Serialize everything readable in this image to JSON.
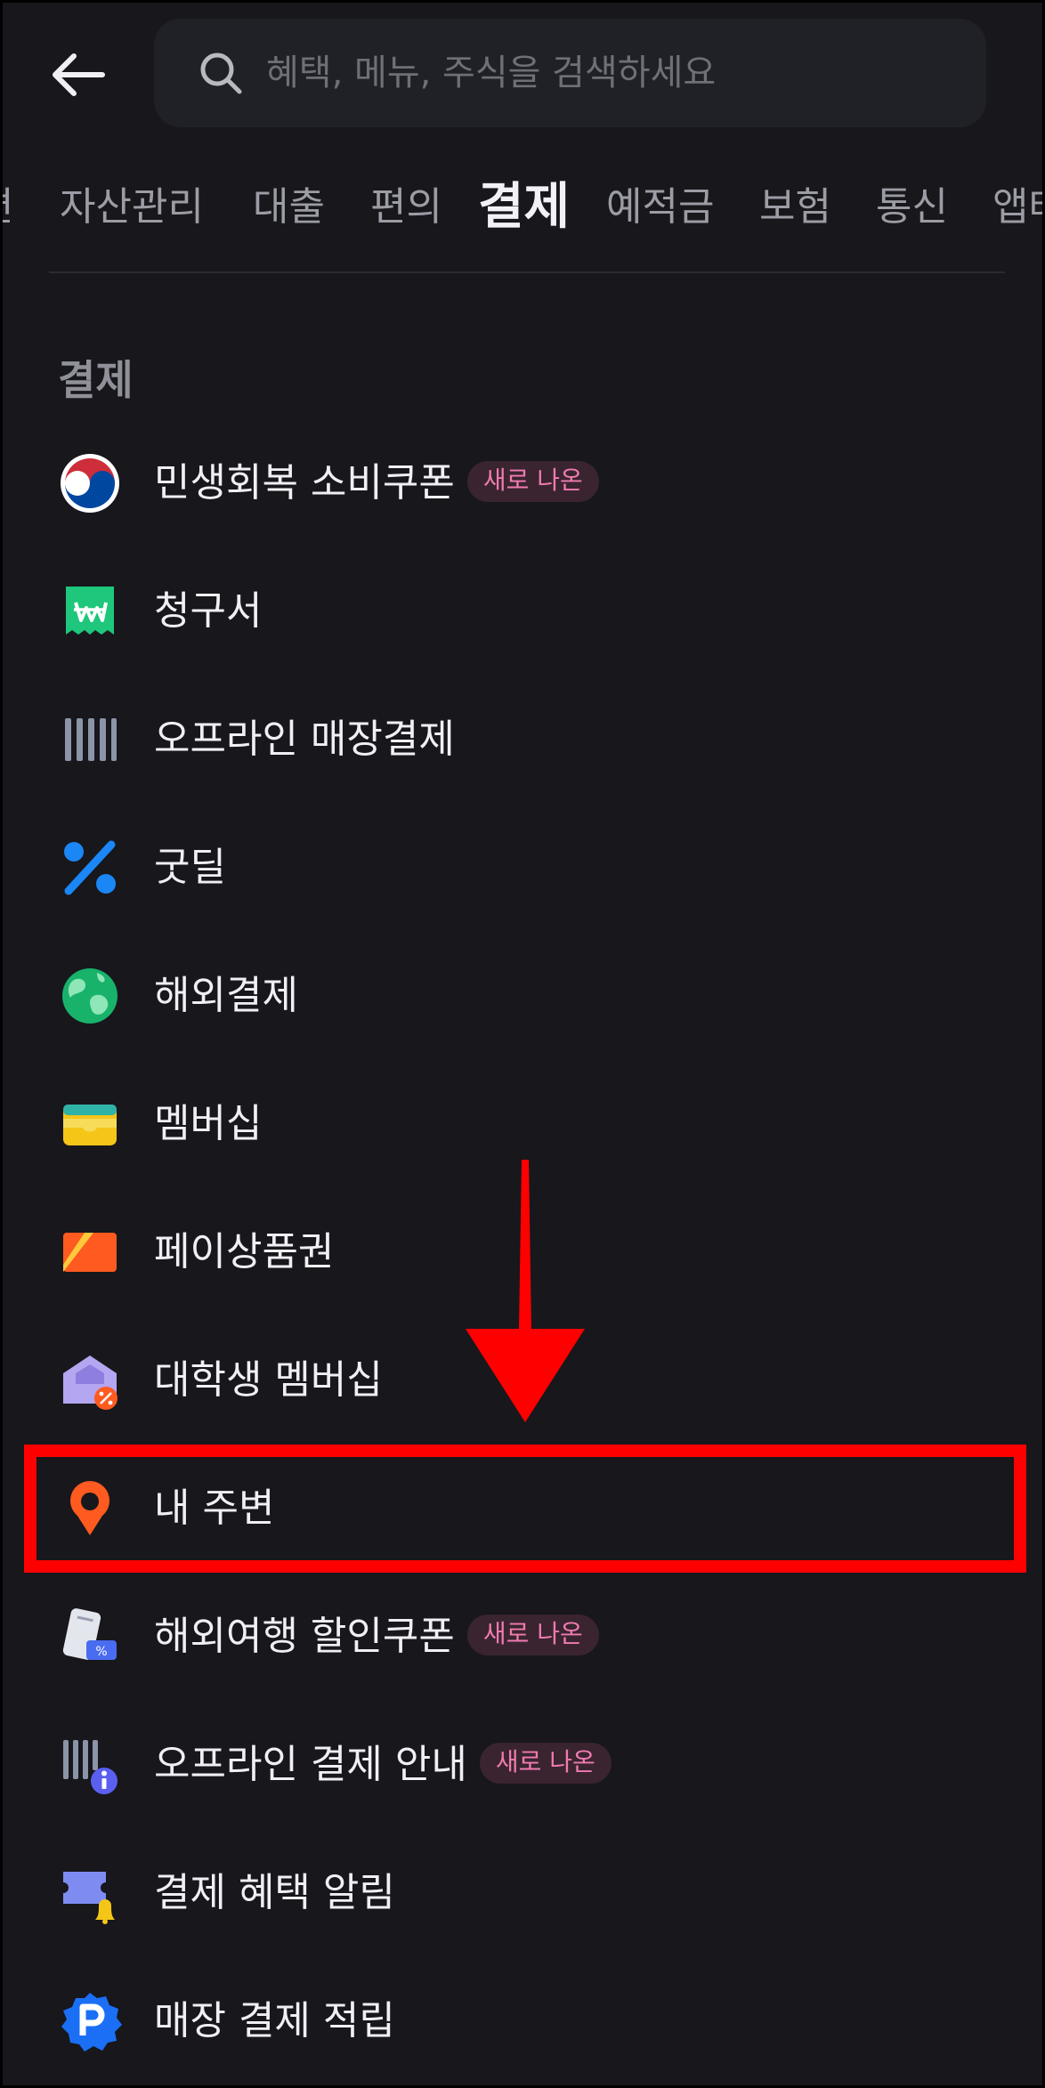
{
  "search": {
    "placeholder": "혜택, 메뉴, 주식을 검색하세요"
  },
  "tabs": [
    {
      "label": "편"
    },
    {
      "label": "자산관리"
    },
    {
      "label": "대출"
    },
    {
      "label": "편의"
    },
    {
      "label": "결제",
      "active": true
    },
    {
      "label": "예적금"
    },
    {
      "label": "보험"
    },
    {
      "label": "통신"
    },
    {
      "label": "앱테"
    }
  ],
  "section": {
    "title": "결제"
  },
  "menu": [
    {
      "label": "민생회복 소비쿠폰",
      "icon": "korea-flag-icon",
      "badge": "새로 나온"
    },
    {
      "label": "청구서",
      "icon": "bill-won-icon"
    },
    {
      "label": "오프라인 매장결제",
      "icon": "barcode-icon"
    },
    {
      "label": "굿딜",
      "icon": "percent-icon"
    },
    {
      "label": "해외결제",
      "icon": "globe-icon"
    },
    {
      "label": "멤버십",
      "icon": "wallet-card-icon"
    },
    {
      "label": "페이상품권",
      "icon": "gift-card-icon"
    },
    {
      "label": "대학생 멤버십",
      "icon": "university-discount-icon"
    },
    {
      "label": "내 주변",
      "icon": "location-pin-icon",
      "highlighted": true
    },
    {
      "label": "해외여행 할인쿠폰",
      "icon": "passport-coupon-icon",
      "badge": "새로 나온"
    },
    {
      "label": "오프라인 결제 안내",
      "icon": "barcode-info-icon",
      "badge": "새로 나온"
    },
    {
      "label": "결제 혜택 알림",
      "icon": "ticket-bell-icon"
    },
    {
      "label": "매장 결제 적립",
      "icon": "pay-points-icon"
    }
  ],
  "colors": {
    "background": "#17171c",
    "highlight": "#ff0000",
    "badge_text": "#f07bb0"
  }
}
